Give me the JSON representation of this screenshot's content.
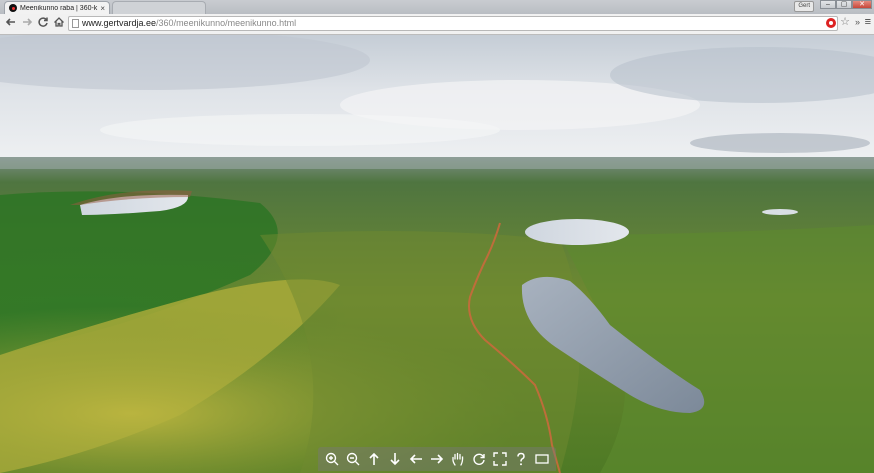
{
  "browser": {
    "tabs": [
      {
        "title": "Meenikunno raba | 360-k",
        "active": true
      },
      {
        "title": "",
        "active": false
      }
    ],
    "user_badge": "Gert",
    "url": {
      "host": "www.gertvardja.ee",
      "path": "/360/meenikunno/meenikunno.html"
    }
  },
  "icons": {
    "back": "arrow-left-icon",
    "forward": "arrow-right-icon",
    "reload": "reload-icon",
    "home": "home-icon",
    "bookmark": "star-icon",
    "menu": "hamburger-icon",
    "extension": "extension-icon"
  },
  "pano_controls": [
    {
      "name": "zoom-in-icon"
    },
    {
      "name": "zoom-out-icon"
    },
    {
      "name": "arrow-up-icon"
    },
    {
      "name": "arrow-down-icon"
    },
    {
      "name": "arrow-left-icon"
    },
    {
      "name": "arrow-right-icon"
    },
    {
      "name": "hand-icon"
    },
    {
      "name": "autorotate-icon"
    },
    {
      "name": "fullscreen-icon"
    },
    {
      "name": "help-icon"
    },
    {
      "name": "hide-controls-icon"
    }
  ],
  "colors": {
    "sky_top": "#cfd7e0",
    "horizon": "#e9ecef",
    "forest": "#3d7a2c",
    "bog": "#8e9a3a",
    "lake": "#8a9cb0",
    "trail": "#c86a3c"
  }
}
